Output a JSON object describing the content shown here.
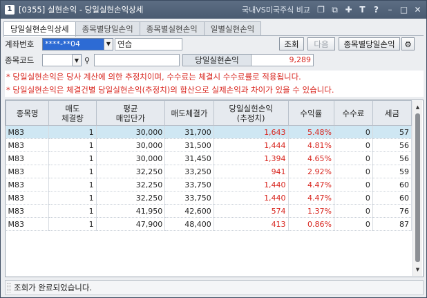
{
  "window": {
    "number": "1",
    "title": "[0355] 실현손익 - 당일실현손익상세",
    "compare_label": "국내VS미국주식 비교"
  },
  "tabs": [
    {
      "label": "당일실현손익상세",
      "active": true
    },
    {
      "label": "종목별당일손익",
      "active": false
    },
    {
      "label": "종목별실현손익",
      "active": false
    },
    {
      "label": "일별실현손익",
      "active": false
    }
  ],
  "form": {
    "account_label": "계좌번호",
    "account_value": "****-**04",
    "account_name": "연습",
    "code_label": "종목코드",
    "query_button": "조회",
    "next_button": "다음",
    "by_stock_button": "종목별당일손익",
    "summary_label": "당일실현손익",
    "summary_value": "9,289"
  },
  "notes": [
    "* 당일실현손익은 당사 계산에 의한 추정치이며, 수수료는 체결시 수수료률로 적용됩니다.",
    "* 당일실현손익은 체결건별 당일실현손익(추정치)의 합산으로 실제손익과 차이가 있을 수 있습니다."
  ],
  "table": {
    "headers": [
      {
        "line1": "종목명",
        "line2": ""
      },
      {
        "line1": "매도",
        "line2": "체결량"
      },
      {
        "line1": "평균",
        "line2": "매입단가"
      },
      {
        "line1": "매도체결가",
        "line2": ""
      },
      {
        "line1": "당일실현손익",
        "line2": "(추정치)"
      },
      {
        "line1": "수익률",
        "line2": ""
      },
      {
        "line1": "수수료",
        "line2": ""
      },
      {
        "line1": "세금",
        "line2": ""
      }
    ],
    "rows": [
      {
        "name": "M83",
        "qty": "1",
        "avg_price": "30,000",
        "sell_price": "31,700",
        "profit": "1,643",
        "rate": "5.48%",
        "fee": "0",
        "tax": "57"
      },
      {
        "name": "M83",
        "qty": "1",
        "avg_price": "30,000",
        "sell_price": "31,500",
        "profit": "1,444",
        "rate": "4.81%",
        "fee": "0",
        "tax": "56"
      },
      {
        "name": "M83",
        "qty": "1",
        "avg_price": "30,000",
        "sell_price": "31,450",
        "profit": "1,394",
        "rate": "4.65%",
        "fee": "0",
        "tax": "56"
      },
      {
        "name": "M83",
        "qty": "1",
        "avg_price": "32,250",
        "sell_price": "33,250",
        "profit": "941",
        "rate": "2.92%",
        "fee": "0",
        "tax": "59"
      },
      {
        "name": "M83",
        "qty": "1",
        "avg_price": "32,250",
        "sell_price": "33,750",
        "profit": "1,440",
        "rate": "4.47%",
        "fee": "0",
        "tax": "60"
      },
      {
        "name": "M83",
        "qty": "1",
        "avg_price": "32,250",
        "sell_price": "33,750",
        "profit": "1,440",
        "rate": "4.47%",
        "fee": "0",
        "tax": "60"
      },
      {
        "name": "M83",
        "qty": "1",
        "avg_price": "41,950",
        "sell_price": "42,600",
        "profit": "574",
        "rate": "1.37%",
        "fee": "0",
        "tax": "76"
      },
      {
        "name": "M83",
        "qty": "1",
        "avg_price": "47,900",
        "sell_price": "48,400",
        "profit": "413",
        "rate": "0.86%",
        "fee": "0",
        "tax": "87"
      }
    ]
  },
  "status": {
    "message": "조회가 완료되었습니다."
  },
  "colors": {
    "profit": "#d8251e",
    "selected_row": "#cfe7f3",
    "account_bg": "#2d6bd4"
  }
}
